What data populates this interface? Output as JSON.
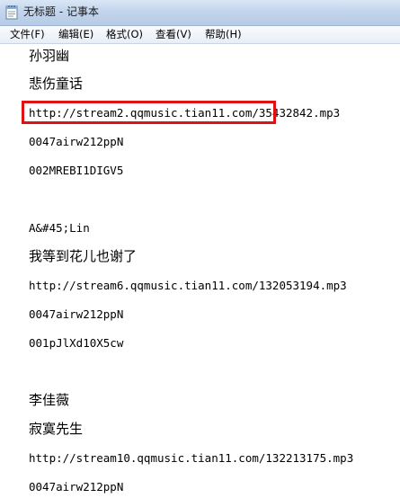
{
  "window": {
    "title": "无标题 - 记事本",
    "icon": "notepad-icon"
  },
  "menubar": {
    "items": [
      "文件(F)",
      "编辑(E)",
      "格式(O)",
      "查看(V)",
      "帮助(H)"
    ]
  },
  "editor": {
    "lines": [
      "孙羽幽",
      "悲伤童话",
      "http://stream2.qqmusic.tian11.com/35432842.mp3",
      "0047airw212ppN",
      "002MREBI1DIGV5",
      "A&#45;Lin",
      "我等到花儿也谢了",
      "http://stream6.qqmusic.tian11.com/132053194.mp3",
      "0047airw212ppN",
      "001pJlXd10X5cw",
      "李佳薇",
      "寂寞先生",
      "http://stream10.qqmusic.tian11.com/132213175.mp3",
      "0047airw212ppN"
    ]
  },
  "annotation": {
    "highlight_color": "#e21111"
  }
}
